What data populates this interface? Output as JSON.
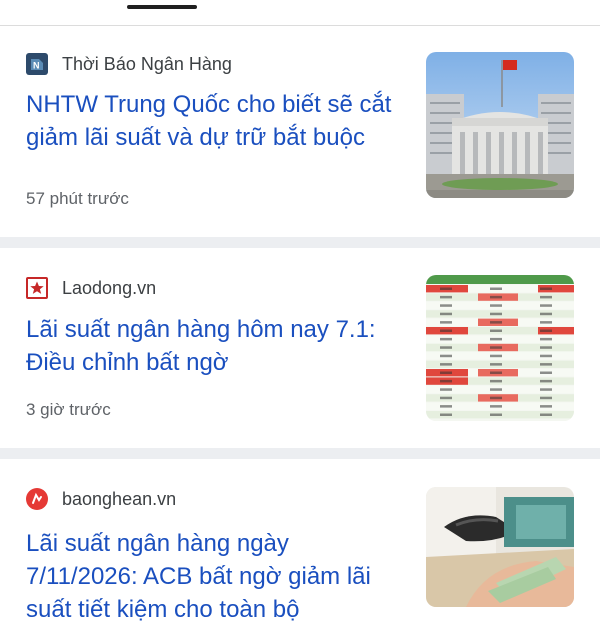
{
  "articles": [
    {
      "source": "Thời Báo Ngân Hàng",
      "source_icon": "newspaper-logo-icon",
      "headline": "NHTW Trung Quốc cho biết sẽ cắt giảm lãi suất và dự trữ bắt buộc",
      "time": "57 phút trước",
      "thumbnail": "central-bank-building"
    },
    {
      "source": "Laodong.vn",
      "source_icon": "star-logo-icon",
      "headline": "Lãi suất ngân hàng hôm nay 7.1: Điều chỉnh bất ngờ",
      "time": "3 giờ trước",
      "thumbnail": "interest-rate-table"
    },
    {
      "source": "baonghean.vn",
      "source_icon": "baonghean-logo-icon",
      "headline": "Lãi suất ngân hàng ngày 7/11/2026: ACB bất ngờ giảm lãi suất tiết kiệm cho toàn bộ",
      "thumbnail": "counting-money-photo"
    }
  ],
  "colors": {
    "headline": "#1a4fbf",
    "separator": "#eceef1",
    "meta": "#5f6368"
  }
}
